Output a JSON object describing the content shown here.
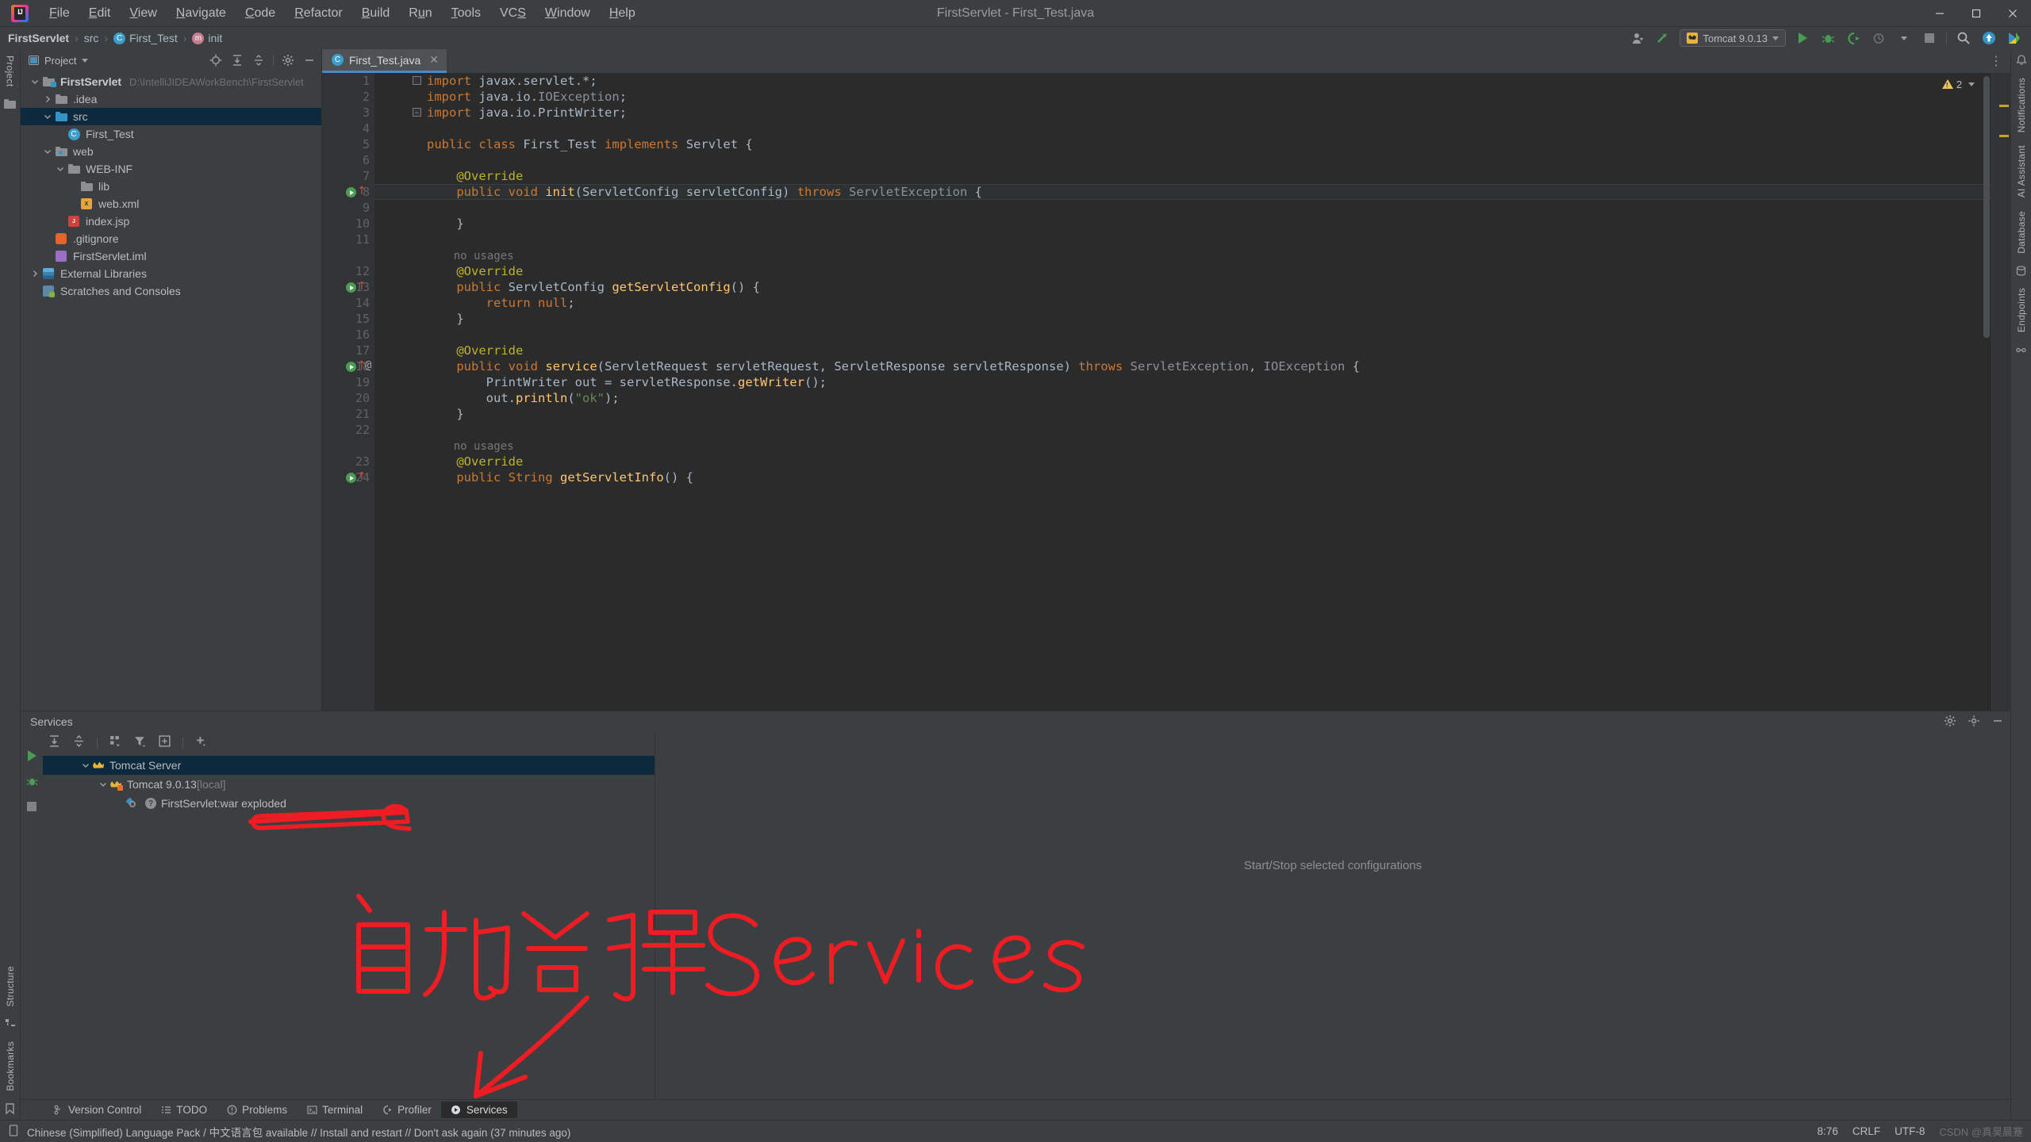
{
  "window": {
    "title": "FirstServlet - First_Test.java",
    "app_icon": "intellij-idea-logo",
    "minimize": "–",
    "maximize": "□",
    "close": "✕"
  },
  "menu": {
    "items": [
      {
        "label": "File",
        "mnemonic": "F"
      },
      {
        "label": "Edit",
        "mnemonic": "E"
      },
      {
        "label": "View",
        "mnemonic": "V"
      },
      {
        "label": "Navigate",
        "mnemonic": "N"
      },
      {
        "label": "Code",
        "mnemonic": "C"
      },
      {
        "label": "Refactor",
        "mnemonic": "R"
      },
      {
        "label": "Build",
        "mnemonic": "B"
      },
      {
        "label": "Run",
        "mnemonic": "u"
      },
      {
        "label": "Tools",
        "mnemonic": "T"
      },
      {
        "label": "VCS",
        "mnemonic": "S"
      },
      {
        "label": "Window",
        "mnemonic": "W"
      },
      {
        "label": "Help",
        "mnemonic": "H"
      }
    ]
  },
  "breadcrumb": {
    "items": [
      {
        "label": "FirstServlet",
        "icon": "",
        "bold": true
      },
      {
        "label": "src",
        "icon": ""
      },
      {
        "label": "First_Test",
        "icon": "class-icon",
        "glyph": "C"
      },
      {
        "label": "init",
        "icon": "method-icon",
        "glyph": "m"
      }
    ],
    "separator": "›"
  },
  "toolbar": {
    "account_icon": "user-account-icon",
    "updates_icon": "search-everywhere-icon",
    "run_config": {
      "label": "Tomcat 9.0.13",
      "icon": "tomcat-icon",
      "chevron": "▾"
    },
    "run_icon": "run-icon",
    "debug_icon": "debug-icon",
    "run_coverage_icon": "run-with-coverage-icon",
    "profile_icon": "profiler-icon",
    "stop_icon": "stop-icon",
    "search_icon": "search-icon",
    "update_project_icon": "update-project-icon",
    "settings_icon": "ide-settings-icon"
  },
  "project_tool_window": {
    "title": "Project",
    "chevron": "▾",
    "actions": [
      "locate-icon",
      "expand-all-icon",
      "collapse-all-icon",
      "settings-icon",
      "hide-icon"
    ],
    "tree": [
      {
        "label": "FirstServlet",
        "path": "D:\\IntelliJIDEAWorkBench\\FirstServlet",
        "indent": 0,
        "icon": "module-folder-icon",
        "arrow": "expanded",
        "bold": true,
        "selected": false
      },
      {
        "label": ".idea",
        "indent": 1,
        "icon": "folder-icon",
        "arrow": "collapsed",
        "selected": false
      },
      {
        "label": "src",
        "indent": 1,
        "icon": "source-folder-icon",
        "arrow": "expanded",
        "selected": true
      },
      {
        "label": "First_Test",
        "indent": 2,
        "icon": "java-class-icon",
        "arrow": "none",
        "selected": false
      },
      {
        "label": "web",
        "indent": 1,
        "icon": "web-folder-icon",
        "arrow": "expanded",
        "selected": false
      },
      {
        "label": "WEB-INF",
        "indent": 2,
        "icon": "folder-icon",
        "arrow": "expanded",
        "selected": false
      },
      {
        "label": "lib",
        "indent": 3,
        "icon": "folder-icon",
        "arrow": "none",
        "selected": false
      },
      {
        "label": "web.xml",
        "indent": 3,
        "icon": "xml-file-icon",
        "arrow": "none",
        "selected": false
      },
      {
        "label": "index.jsp",
        "indent": 2,
        "icon": "jsp-file-icon",
        "arrow": "none",
        "selected": false
      },
      {
        "label": ".gitignore",
        "indent": 1,
        "icon": "gitignore-file-icon",
        "arrow": "none",
        "selected": false
      },
      {
        "label": "FirstServlet.iml",
        "indent": 1,
        "icon": "iml-file-icon",
        "arrow": "none",
        "selected": false
      },
      {
        "label": "External Libraries",
        "indent": 0,
        "icon": "libraries-icon",
        "arrow": "collapsed",
        "selected": false
      },
      {
        "label": "Scratches and Consoles",
        "indent": 0,
        "icon": "scratches-icon",
        "arrow": "none",
        "selected": false
      }
    ]
  },
  "editor": {
    "tab": {
      "label": "First_Test.java",
      "icon": "java-class-icon",
      "close": "✕"
    },
    "warnings": {
      "count": "2",
      "icon": "warning-icon"
    },
    "caret_line": 8,
    "lines": [
      {
        "n": "1",
        "text": "import javax.servlet.*;",
        "fold": "expanded"
      },
      {
        "n": "2",
        "text": "import java.io.IOException;"
      },
      {
        "n": "3",
        "text": "import java.io.PrintWriter;",
        "fold": "collapsed-end"
      },
      {
        "n": "4",
        "text": ""
      },
      {
        "n": "5",
        "text": "public class First_Test implements Servlet {"
      },
      {
        "n": "6",
        "text": ""
      },
      {
        "n": "7",
        "text": "    @Override"
      },
      {
        "n": "8",
        "text": "    public void init(ServletConfig servletConfig) throws ServletException {",
        "gutter_run": true,
        "override": true
      },
      {
        "n": "9",
        "text": ""
      },
      {
        "n": "10",
        "text": "    }"
      },
      {
        "n": "11",
        "text": ""
      },
      {
        "n": "",
        "text": "    no usages",
        "inlay": true
      },
      {
        "n": "12",
        "text": "    @Override"
      },
      {
        "n": "13",
        "text": "    public ServletConfig getServletConfig() {",
        "gutter_run": true,
        "override": true
      },
      {
        "n": "14",
        "text": "        return null;"
      },
      {
        "n": "15",
        "text": "    }"
      },
      {
        "n": "16",
        "text": ""
      },
      {
        "n": "17",
        "text": "    @Override"
      },
      {
        "n": "18",
        "text": "    public void service(ServletRequest servletRequest, ServletResponse servletResponse) throws ServletException, IOException {",
        "gutter_run": true,
        "override": true,
        "at": true
      },
      {
        "n": "19",
        "text": "        PrintWriter out = servletResponse.getWriter();"
      },
      {
        "n": "20",
        "text": "        out.println(\"ok\");"
      },
      {
        "n": "21",
        "text": "    }"
      },
      {
        "n": "22",
        "text": ""
      },
      {
        "n": "",
        "text": "    no usages",
        "inlay": true
      },
      {
        "n": "23",
        "text": "    @Override"
      },
      {
        "n": "24",
        "text": "    public String getServletInfo() {",
        "gutter_run": true,
        "override": true
      }
    ]
  },
  "services_tool_window": {
    "title": "Services",
    "header_actions": [
      "settings-icon",
      "more-icon",
      "hide-icon"
    ],
    "rail_actions": [
      "run-icon",
      "debug-icon",
      "stop-icon"
    ],
    "toolbar_actions": [
      "expand-all-icon",
      "collapse-all-icon",
      "group-icon",
      "filter-icon",
      "new-tab-icon",
      "add-icon"
    ],
    "tree": [
      {
        "label": "Tomcat Server",
        "indent": 0,
        "icon": "tomcat-icon",
        "arrow": "expanded",
        "selected": true
      },
      {
        "label": "Tomcat 9.0.13",
        "suffix": "[local]",
        "indent": 1,
        "icon": "tomcat-warning-icon",
        "arrow": "expanded",
        "selected": false
      },
      {
        "label": "FirstServlet:war exploded",
        "indent": 2,
        "icon": "artifact-icon",
        "arrow": "none",
        "selected": false
      }
    ],
    "detail_placeholder": "Start/Stop selected configurations"
  },
  "left_rail": {
    "tabs": [
      "Project",
      "Structure",
      "Bookmarks"
    ]
  },
  "right_rail": {
    "tabs": [
      "Notifications",
      "AI Assistant",
      "Database",
      "Endpoints"
    ]
  },
  "bottom_tabs": [
    {
      "label": "Version Control",
      "icon": "version-control-icon",
      "active": false
    },
    {
      "label": "TODO",
      "icon": "todo-icon",
      "active": false
    },
    {
      "label": "Problems",
      "icon": "problems-icon",
      "active": false
    },
    {
      "label": "Terminal",
      "icon": "terminal-icon",
      "active": false
    },
    {
      "label": "Profiler",
      "icon": "profiler-icon",
      "active": false
    },
    {
      "label": "Services",
      "icon": "services-icon",
      "active": true
    }
  ],
  "status_bar": {
    "icon": "notification-icon",
    "message": "Chinese (Simplified) Language Pack / 中文语言包 available // Install and restart // Don't ask again (37 minutes ago)",
    "position": "8:76",
    "line_separator": "CRLF",
    "encoding": "UTF-8",
    "watermark": "CSDN @真昊晨蹇"
  },
  "annotation": {
    "handwritten_text": "自动会弹 Services",
    "color": "#ee1c23",
    "arrow_target": "Tomcat 9.0.13 [local]"
  },
  "colors": {
    "background": "#3c3f41",
    "editor_background": "#2b2b2b",
    "selection": "#0d293e",
    "accent": "#4a88c7",
    "keyword": "#cc7832",
    "method": "#ffc66d",
    "annotation": "#bbb529",
    "string": "#6a8759",
    "text": "#a9b7c6",
    "annotation_red": "#ee1c23"
  }
}
